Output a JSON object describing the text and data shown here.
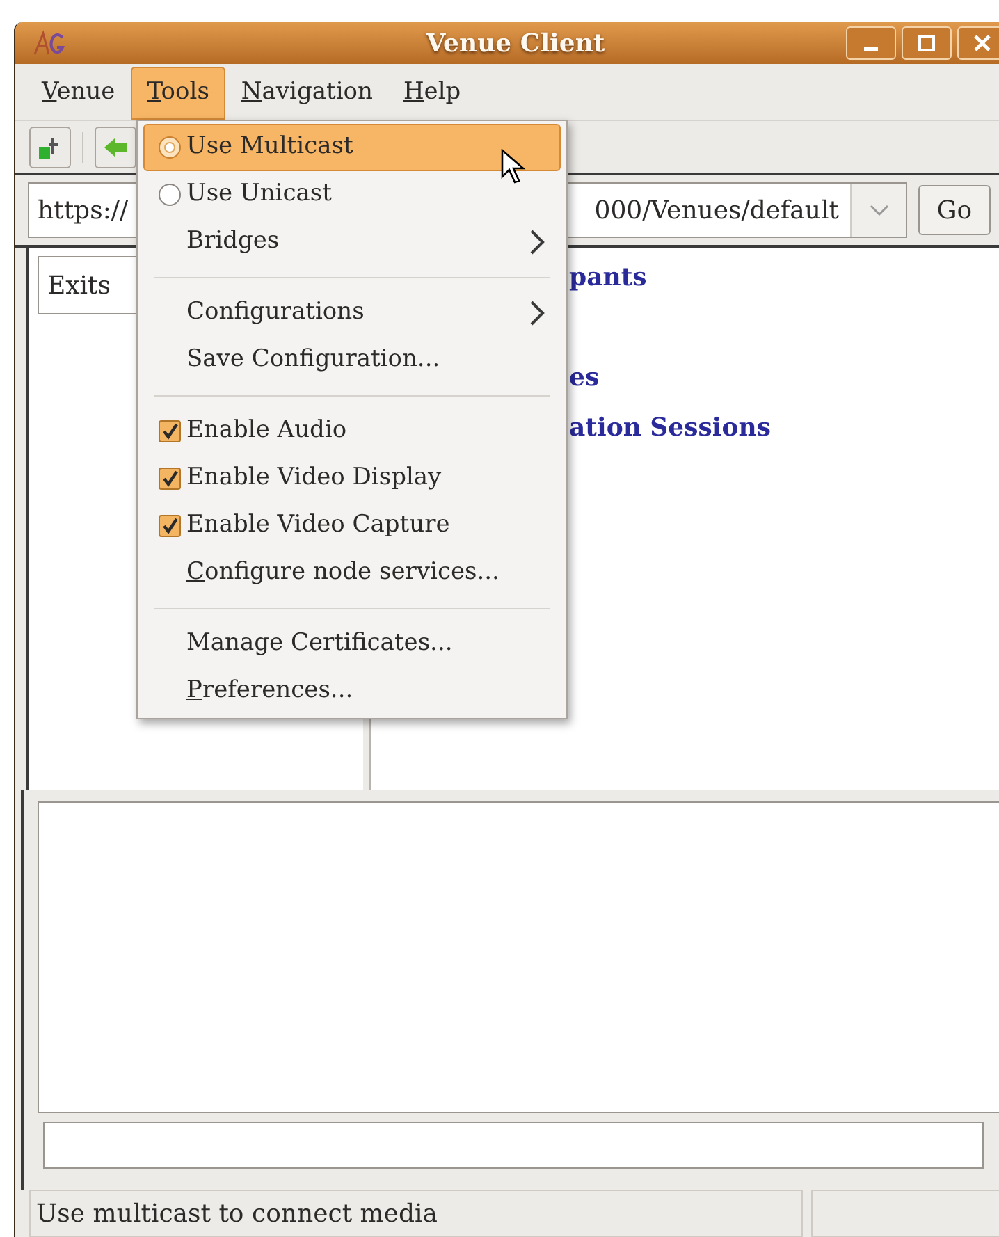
{
  "window": {
    "title": "Venue Client"
  },
  "menubar": [
    {
      "label": "Venue",
      "selected": false,
      "underline_first": true
    },
    {
      "label": "Tools",
      "selected": true,
      "underline_first": true
    },
    {
      "label": "Navigation",
      "selected": false,
      "underline_first": true
    },
    {
      "label": "Help",
      "selected": false,
      "underline_first": true
    }
  ],
  "url_bar": {
    "value_start": "https://",
    "value_end": "000/Venues/default",
    "go_button": "Go"
  },
  "left_panel": {
    "tab": "Exits"
  },
  "right_panel": {
    "links": [
      "pants",
      "es",
      "ation Sessions"
    ]
  },
  "tools_menu": [
    {
      "kind": "radio",
      "label": "Use Multicast",
      "selected": true,
      "highlighted": true,
      "underline_first": false
    },
    {
      "kind": "radio",
      "label": "Use Unicast",
      "selected": false,
      "highlighted": false,
      "underline_first": false
    },
    {
      "kind": "submenu",
      "label": "Bridges",
      "highlighted": false,
      "underline_first": false
    },
    {
      "kind": "separator"
    },
    {
      "kind": "submenu",
      "label": "Configurations",
      "highlighted": false,
      "underline_first": false
    },
    {
      "kind": "plain",
      "label": "Save Configuration...",
      "highlighted": false,
      "underline_first": false
    },
    {
      "kind": "separator"
    },
    {
      "kind": "check",
      "label": "Enable Audio",
      "checked": true,
      "highlighted": false,
      "underline_first": false
    },
    {
      "kind": "check",
      "label": "Enable Video Display",
      "checked": true,
      "highlighted": false,
      "underline_first": false
    },
    {
      "kind": "check",
      "label": "Enable Video Capture",
      "checked": true,
      "highlighted": false,
      "underline_first": false
    },
    {
      "kind": "plain",
      "label": "Configure node services...",
      "highlighted": false,
      "underline_first": true
    },
    {
      "kind": "separator"
    },
    {
      "kind": "plain",
      "label": "Manage Certificates...",
      "highlighted": false,
      "underline_first": false
    },
    {
      "kind": "plain",
      "label": "Preferences...",
      "highlighted": false,
      "underline_first": true
    }
  ],
  "status_bar": {
    "text": "Use multicast to connect media"
  }
}
